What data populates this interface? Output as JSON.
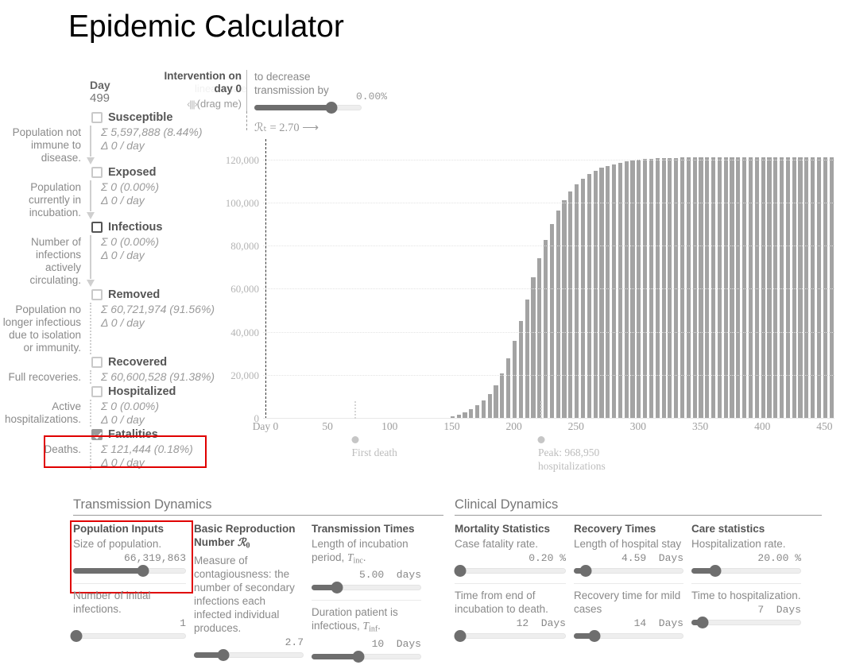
{
  "app": {
    "title": "Epidemic Calculator"
  },
  "day": {
    "label": "Day",
    "value": "499"
  },
  "intervention": {
    "title_line1": "Intervention on",
    "title_line2": "day 0",
    "drag_hint": "(drag me)",
    "drag_glyph": "‹|||›",
    "desc_line1": "to decrease",
    "desc_line2": "transmission by",
    "slider_value": "0.00%",
    "slider_percent": 72,
    "rt_text": "ℛₜ = 2.70 ⟶",
    "ghost_text": "linear scale"
  },
  "compartments": [
    {
      "name": "Susceptible",
      "checkbox": "unchecked",
      "description": "Population not immune to disease.",
      "sum": "Σ  5,597,888 (8.44%)",
      "delta": "Δ  0 / day",
      "connector": "arrow"
    },
    {
      "name": "Exposed",
      "checkbox": "unchecked",
      "description": "Population currently in incubation.",
      "sum": "Σ  0 (0.00%)",
      "delta": "Δ  0 / day",
      "connector": "arrow"
    },
    {
      "name": "Infectious",
      "checkbox": "unchecked-dark",
      "description": "Number of infections actively circulating.",
      "sum": "Σ  0 (0.00%)",
      "delta": "Δ  0 / day",
      "connector": "arrow"
    },
    {
      "name": "Removed",
      "checkbox": "unchecked",
      "description": "Population no longer infectious due to isolation or immunity.",
      "sum": "Σ  60,721,974 (91.56%)",
      "delta": "Δ  0 / day",
      "connector": "dotted"
    },
    {
      "name": "Recovered",
      "checkbox": "unchecked",
      "description": "Full recoveries.",
      "sum": "Σ  60,600,528 (91.38%)",
      "delta": "",
      "connector": "dotted"
    },
    {
      "name": "Hospitalized",
      "checkbox": "unchecked",
      "description": "Active hospitalizations.",
      "sum": "Σ  0 (0.00%)",
      "delta": "Δ  0 / day",
      "connector": "dotted"
    },
    {
      "name": "Fatalities",
      "checkbox": "checked",
      "description": "Deaths.",
      "sum": "Σ  121,444 (0.18%)",
      "delta": "Δ  0 / day",
      "connector": "dotted"
    }
  ],
  "highlight_color": "#e00000",
  "chart_data": {
    "type": "bar",
    "title": "",
    "xlabel": "",
    "ylabel": "",
    "grid": true,
    "xlim": [
      0,
      460
    ],
    "ylim": [
      0,
      128000
    ],
    "ytick_labels": [
      "0",
      "20,000",
      "40,000",
      "60,000",
      "80,000",
      "100,000",
      "120,000"
    ],
    "yticks": [
      0,
      20000,
      40000,
      60000,
      80000,
      100000,
      120000
    ],
    "xtick_labels": [
      "Day 0",
      "50",
      "100",
      "150",
      "200",
      "250",
      "300",
      "350",
      "400",
      "450"
    ],
    "xticks": [
      0,
      50,
      100,
      150,
      200,
      250,
      300,
      350,
      400,
      450
    ],
    "series_name": "Fatalities (cumulative)",
    "bar_color": "#a3a3a3",
    "x": [
      0,
      5,
      10,
      15,
      20,
      25,
      30,
      35,
      40,
      45,
      50,
      55,
      60,
      65,
      70,
      75,
      80,
      85,
      90,
      95,
      100,
      105,
      110,
      115,
      120,
      125,
      130,
      135,
      140,
      145,
      150,
      155,
      160,
      165,
      170,
      175,
      180,
      185,
      190,
      195,
      200,
      205,
      210,
      215,
      220,
      225,
      230,
      235,
      240,
      245,
      250,
      255,
      260,
      265,
      270,
      275,
      280,
      285,
      290,
      295,
      300,
      305,
      310,
      315,
      320,
      325,
      330,
      335,
      340,
      345,
      350,
      355,
      360,
      365,
      370,
      375,
      380,
      385,
      390,
      395,
      400,
      405,
      410,
      415,
      420,
      425,
      430,
      435,
      440,
      445,
      450,
      455
    ],
    "values": [
      0,
      0,
      0,
      0,
      0,
      0,
      0,
      0,
      0,
      0,
      0,
      0,
      0,
      0,
      0,
      0,
      0,
      0,
      0,
      0,
      0,
      0,
      0,
      0,
      0,
      0,
      60,
      120,
      260,
      520,
      1000,
      1800,
      3000,
      4400,
      6200,
      8600,
      11500,
      15500,
      21000,
      28000,
      36000,
      45500,
      55500,
      65500,
      74500,
      83000,
      90500,
      96500,
      101500,
      105500,
      108800,
      111400,
      113500,
      115100,
      116400,
      117400,
      118200,
      118900,
      119400,
      119800,
      120200,
      120450,
      120650,
      120850,
      121000,
      121100,
      121180,
      121250,
      121300,
      121340,
      121370,
      121395,
      121410,
      121420,
      121428,
      121432,
      121436,
      121438,
      121440,
      121441,
      121442,
      121443,
      121443,
      121444,
      121444,
      121444,
      121444,
      121444,
      121444,
      121444,
      121444,
      121444
    ],
    "annotations": [
      {
        "name": "day0-line",
        "x": 0,
        "style": "dashed-vertical-black"
      },
      {
        "name": "first-death-marker",
        "x": 72,
        "label": "First death"
      },
      {
        "name": "peak-marker",
        "x": 222,
        "label": "Peak: 968,950 hospitalizations"
      }
    ]
  },
  "sections": [
    {
      "id": "transmission-dynamics",
      "title": "Transmission Dynamics",
      "columns": [
        {
          "id": "population-inputs",
          "head": "Population Inputs",
          "head_math": "",
          "desc": "Size of population.",
          "controls": [
            {
              "name": "population-size",
              "value": "66,319,863",
              "percent": 62,
              "unit": ""
            },
            {
              "name": "initial-infections",
              "desc": "Number of initial infections.",
              "value": "1",
              "percent": 3,
              "unit": ""
            }
          ]
        },
        {
          "id": "basic-reproduction-number",
          "head": "Basic Reproduction",
          "head_line2": "Number",
          "head_math": "R0",
          "desc": "Measure of contagiousness: the number of secondary infections each infected individual produces.",
          "controls": [
            {
              "name": "r0-slider",
              "value": "2.7",
              "percent": 27,
              "unit": ""
            }
          ]
        },
        {
          "id": "transmission-times",
          "head": "Transmission Times",
          "desc": "Length of incubation period,",
          "desc_math": "Tinc.",
          "controls": [
            {
              "name": "incubation-period",
              "value": "5.00  days",
              "percent": 23,
              "unit": "days"
            },
            {
              "name": "infectious-duration",
              "desc": "Duration patient is infectious,",
              "desc_math": "Tinf.",
              "value": "10  Days",
              "percent": 43,
              "unit": "Days"
            }
          ]
        }
      ]
    },
    {
      "id": "clinical-dynamics",
      "title": "Clinical Dynamics",
      "columns": [
        {
          "id": "mortality-statistics",
          "head": "Mortality Statistics",
          "desc": "Case fatality rate.",
          "controls": [
            {
              "name": "case-fatality-rate",
              "value": "0.20 %",
              "percent": 5,
              "unit": "%"
            },
            {
              "name": "time-incubation-to-death",
              "desc": "Time from end of incubation to death.",
              "value": "12  Days",
              "percent": 5,
              "unit": "Days"
            }
          ]
        },
        {
          "id": "recovery-times",
          "head": "Recovery Times",
          "desc": "Length of hospital stay",
          "controls": [
            {
              "name": "hospital-stay-length",
              "value": "4.59  Days",
              "percent": 11,
              "unit": "Days"
            },
            {
              "name": "mild-case-recovery-time",
              "desc": "Recovery time for mild cases",
              "value": "14  Days",
              "percent": 19,
              "unit": "Days"
            }
          ]
        },
        {
          "id": "care-statistics",
          "head": "Care statistics",
          "desc": "Hospitalization rate.",
          "controls": [
            {
              "name": "hospitalization-rate",
              "value": "20.00 %",
              "percent": 22,
              "unit": "%"
            },
            {
              "name": "time-to-hospitalization",
              "desc": "Time to hospitalization.",
              "value": "7  Days",
              "percent": 10,
              "unit": "Days"
            }
          ]
        }
      ]
    }
  ]
}
